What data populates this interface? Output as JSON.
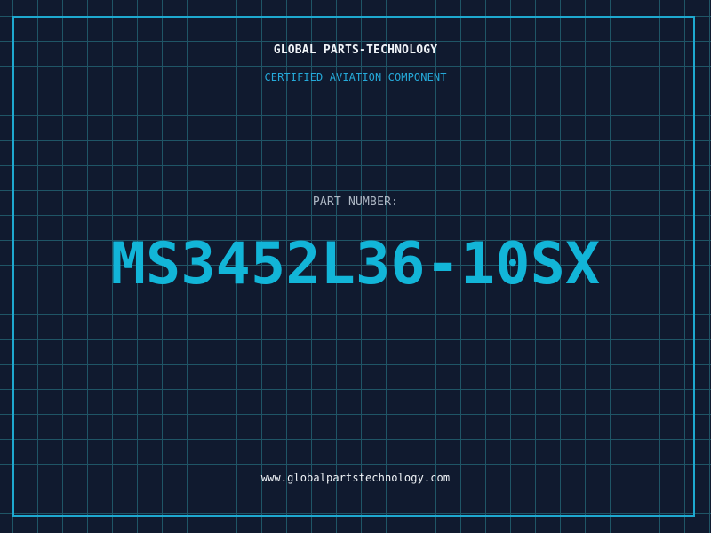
{
  "brand": {
    "company": "GLOBAL PARTS-TECHNOLOGY",
    "subtitle": "CERTIFIED AVIATION COMPONENT",
    "website": "www.globalpartstechnology.com"
  },
  "part": {
    "label": "PART NUMBER:",
    "number": "MS3452L36-10SX"
  },
  "colors": {
    "background": "#101a2f",
    "grid": "#1f5566",
    "accent": "#1ea8cf",
    "text": "#f0f4f8"
  }
}
